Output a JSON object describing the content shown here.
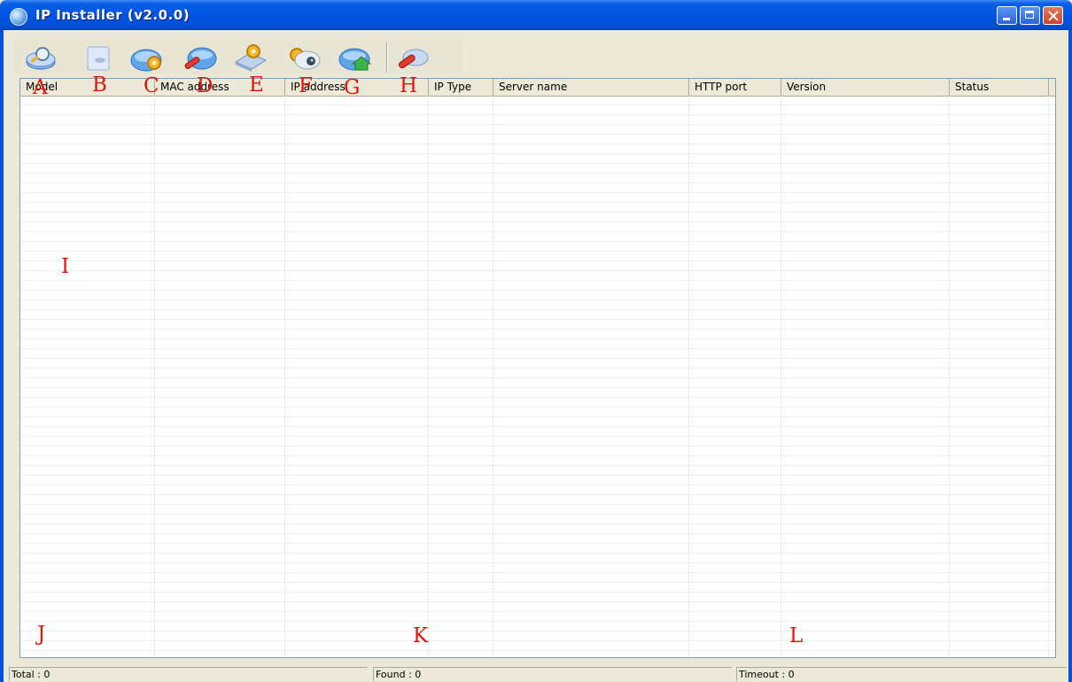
{
  "window": {
    "title": "IP Installer (v2.0.0)"
  },
  "toolbar": {
    "buttons": [
      {
        "icon": "search-icon"
      },
      {
        "icon": "document-icon"
      },
      {
        "icon": "globe-gear-icon"
      },
      {
        "icon": "globe-wrench-icon"
      },
      {
        "icon": "disk-gear-icon"
      },
      {
        "icon": "camera-gear-icon"
      },
      {
        "icon": "globe-home-icon"
      },
      {
        "icon": "wrench-icon"
      }
    ]
  },
  "table": {
    "columns": [
      "Model",
      "MAC address",
      "IP address",
      "IP Type",
      "Server name",
      "HTTP port",
      "Version",
      "Status"
    ]
  },
  "status": {
    "total": "Total : 0",
    "found": "Found : 0",
    "timeout": "Timeout : 0"
  },
  "annotations": {
    "A": "A",
    "B": "B",
    "C": "C",
    "D": "D",
    "E": "E",
    "F": "F",
    "G": "G",
    "H": "H",
    "I": "I",
    "J": "J",
    "K": "K",
    "L": "L"
  },
  "colors": {
    "title_bar": "#0054e3",
    "annotation": "#e3130b",
    "window_bg": "#ece9d8"
  }
}
